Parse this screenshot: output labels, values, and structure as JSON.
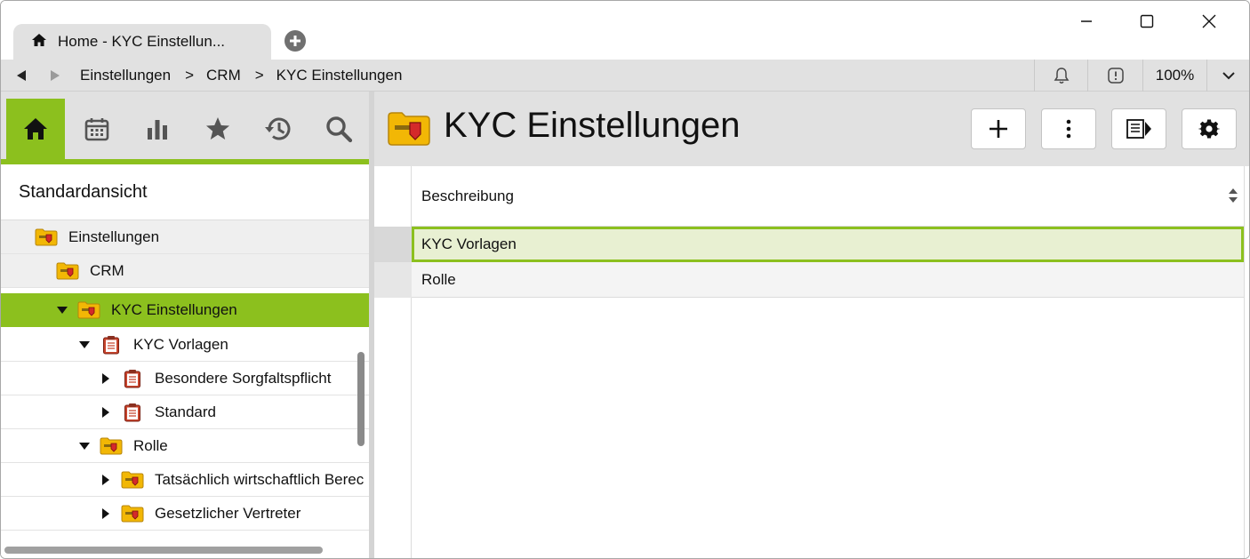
{
  "tab": {
    "title": "Home - KYC Einstellun..."
  },
  "window_controls": {
    "minimize": "minimize-icon",
    "maximize": "maximize-icon",
    "close": "close-icon"
  },
  "breadcrumb": {
    "items": [
      "Einstellungen",
      "CRM",
      "KYC Einstellungen"
    ],
    "separator": ">"
  },
  "toolbar": {
    "zoom": "100%"
  },
  "left_panel": {
    "icons": [
      "home-icon",
      "calendar-icon",
      "chart-icon",
      "star-icon",
      "history-icon",
      "search-icon"
    ],
    "view_name": "Standardansicht",
    "tree": [
      {
        "label": "Einstellungen",
        "level": 0,
        "icon": "folder-key-icon",
        "expander": "none"
      },
      {
        "label": "CRM",
        "level": 1,
        "icon": "folder-key-icon",
        "expander": "none"
      },
      {
        "label": "KYC Einstellungen",
        "level": 2,
        "icon": "folder-key-icon",
        "expander": "expanded",
        "selected": true
      },
      {
        "label": "KYC Vorlagen",
        "level": 3,
        "icon": "clipboard-icon",
        "expander": "expanded"
      },
      {
        "label": "Besondere Sorgfaltspflicht",
        "level": 4,
        "icon": "clipboard-icon",
        "expander": "collapsed"
      },
      {
        "label": "Standard",
        "level": 4,
        "icon": "clipboard-icon",
        "expander": "collapsed"
      },
      {
        "label": "Rolle",
        "level": 3,
        "icon": "folder-key-icon",
        "expander": "expanded"
      },
      {
        "label": "Tatsächlich wirtschaftlich Berec",
        "level": 4,
        "icon": "folder-key-icon",
        "expander": "collapsed"
      },
      {
        "label": "Gesetzlicher Vertreter",
        "level": 4,
        "icon": "folder-key-icon",
        "expander": "collapsed"
      }
    ]
  },
  "main": {
    "title": "KYC Einstellungen",
    "actions": [
      "plus-icon",
      "more-vertical-icon",
      "panel-toggle-icon",
      "gear-icon"
    ],
    "column_header": "Beschreibung",
    "rows": [
      "KYC Vorlagen",
      "Rolle"
    ]
  },
  "colors": {
    "accent": "#8cc01e",
    "selected_row": "#e8f0d2",
    "chrome": "#e1e1e1"
  }
}
